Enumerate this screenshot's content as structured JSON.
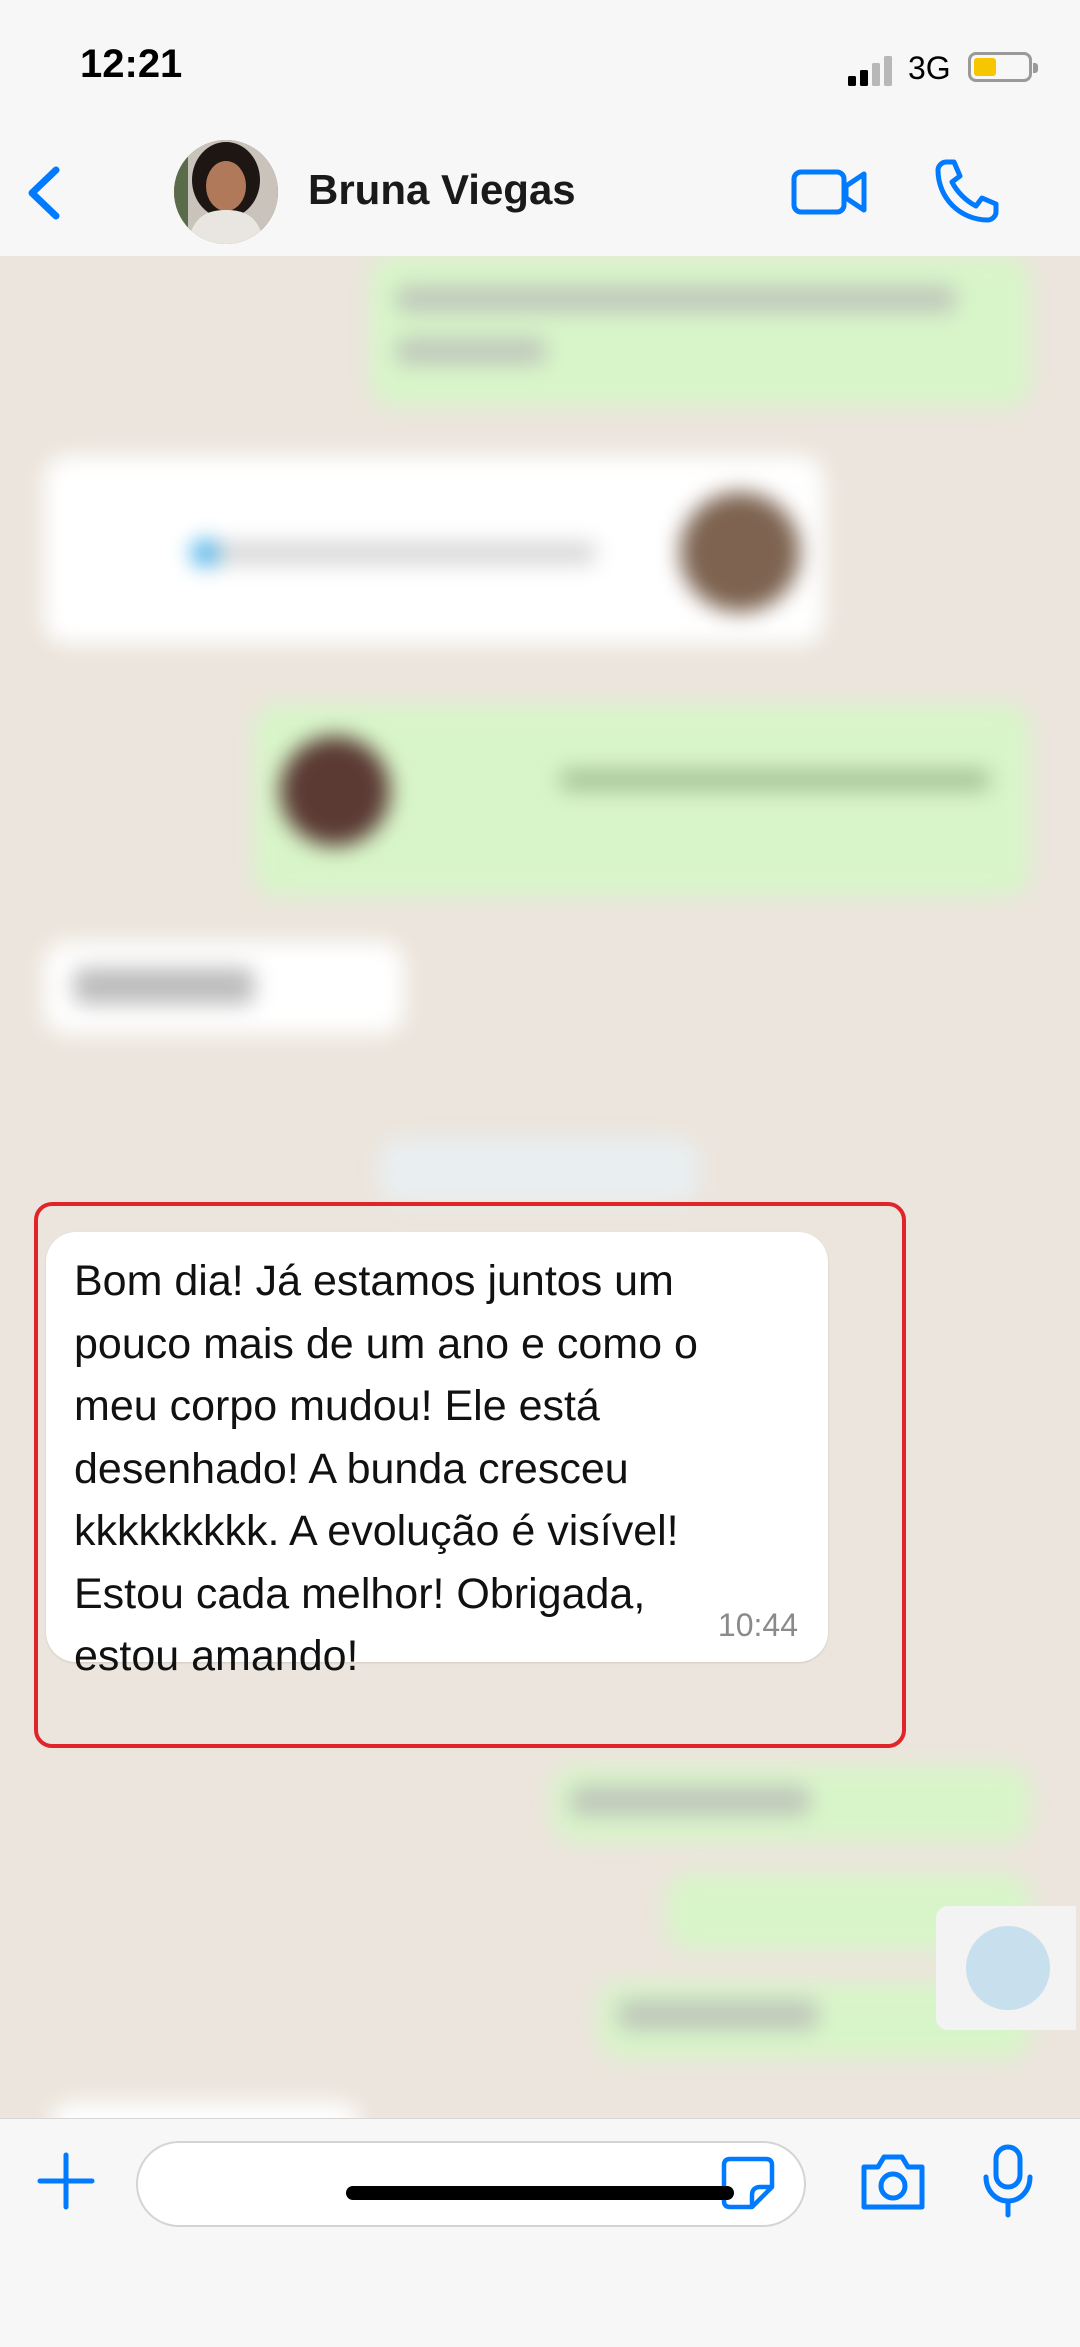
{
  "status_bar": {
    "time": "12:21",
    "network": "3G"
  },
  "header": {
    "contact_name": "Bruna Viegas"
  },
  "highlighted_message": {
    "text": "Bom dia! Já estamos juntos um\npouco mais de um ano e como o\nmeu corpo mudou! Ele está\ndesenhado! A bunda cresceu\nkkkkkkkkk. A evolução é visível!\nEstou cada melhor! Obrigada,\nestou amando!",
    "time": "10:44"
  },
  "colors": {
    "accent": "#007aff",
    "highlight_border": "#e0242a",
    "sent_bubble": "#d8f5c9"
  },
  "icons": [
    "back-chevron-icon",
    "video-call-icon",
    "phone-icon",
    "plus-icon",
    "sticker-icon",
    "camera-icon",
    "microphone-icon"
  ]
}
